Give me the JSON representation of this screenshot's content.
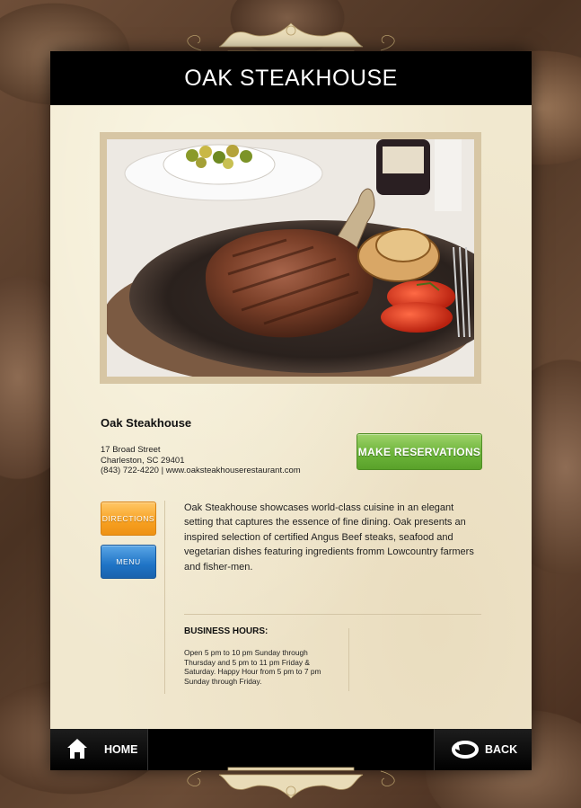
{
  "header": {
    "title": "OAK STEAKHOUSE"
  },
  "restaurant": {
    "name": "Oak Steakhouse",
    "address_line1": "17 Broad Street",
    "address_line2": "Charleston, SC 29401",
    "contact": "(843) 722-4220 | www.oaksteakhouserestaurant.com"
  },
  "buttons": {
    "reservations": "MAKE RESERVATIONS",
    "directions": "DIRECTIONS",
    "menu": "MENU"
  },
  "description": "Oak Steakhouse showcases world-class cuisine in an elegant setting that captures the essence of fine dining. Oak presents an inspired selection of certified Angus Beef steaks, seafood and vegetarian dishes featuring ingredients fromm Lowcountry farmers and fisher-men.",
  "hours": {
    "title": "BUSINESS HOURS:",
    "text": "Open 5 pm to 10 pm Sunday through Thursday and 5 pm to 11 pm Friday & Saturday. Happy Hour from 5 pm to 7 pm Sunday through Friday."
  },
  "footer": {
    "home_label": "HOME",
    "back_label": "BACK"
  },
  "icons": {
    "home": "home-icon",
    "back": "back-arrow-icon"
  },
  "colors": {
    "reservations_button": "#6cb43a",
    "directions_button": "#f7a021",
    "menu_button": "#1f74c6",
    "header_bg": "#000000",
    "panel_bg": "#f1e8cf"
  }
}
